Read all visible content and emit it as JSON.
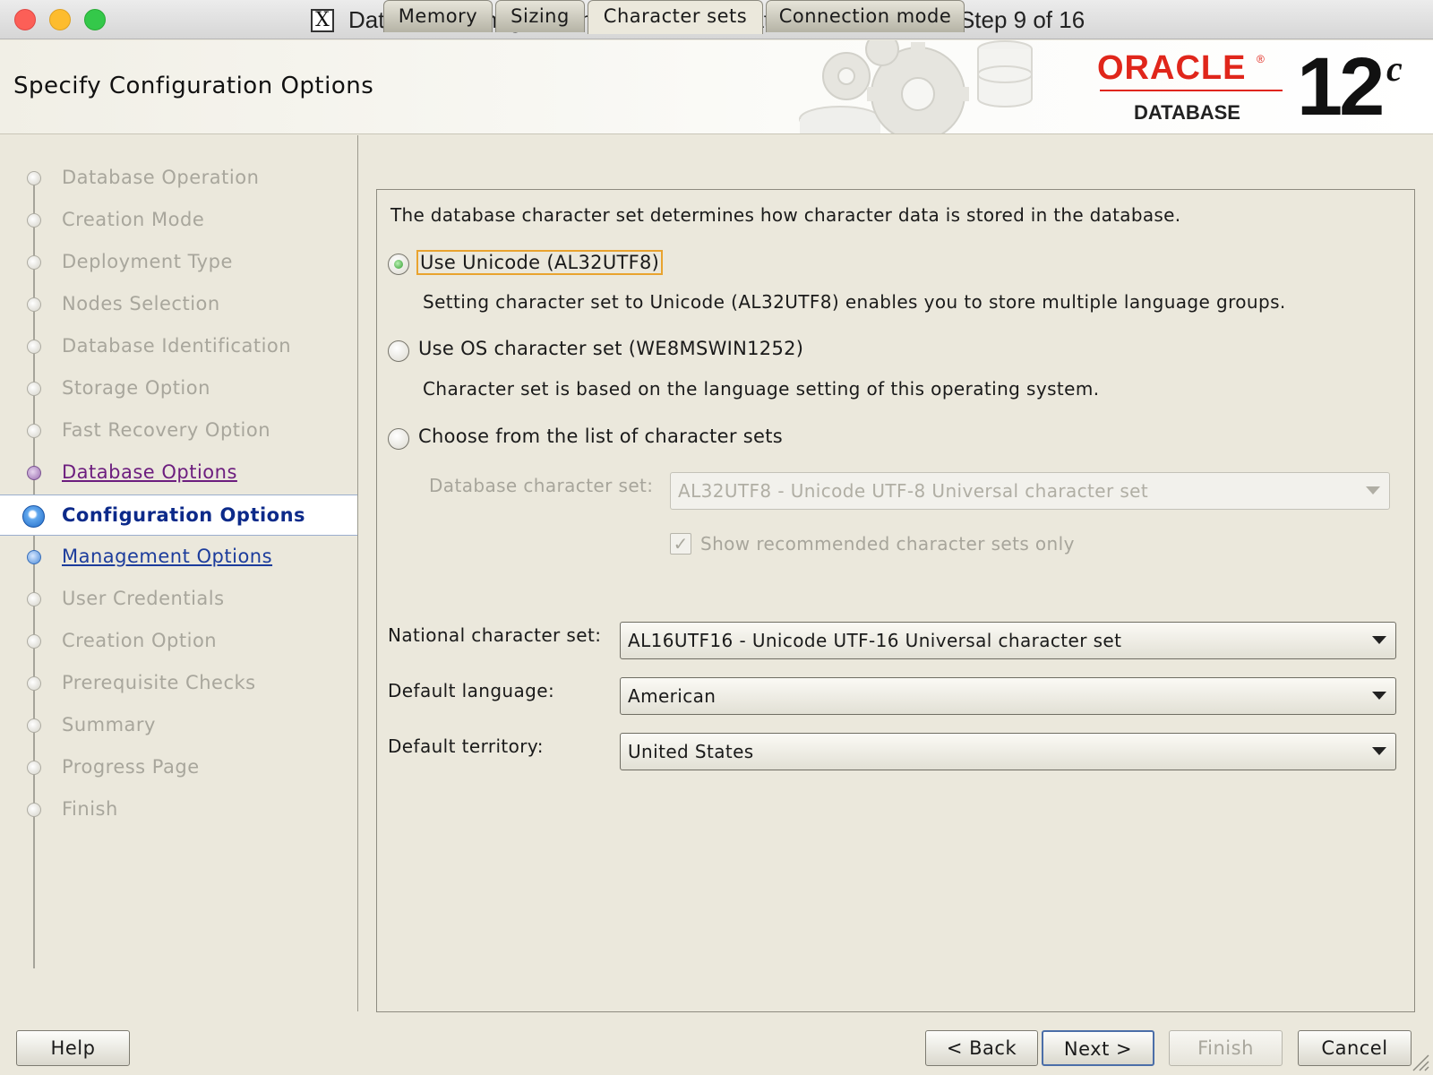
{
  "window": {
    "title": "Database Configuration Assistant - Create 'orcl' database - Step 9 of 16"
  },
  "header": {
    "heading": "Specify Configuration Options",
    "logo_word": "ORACLE",
    "logo_trademark": "®",
    "logo_product": "DATABASE",
    "logo_version": "12",
    "logo_version_sup": "c"
  },
  "steps": [
    {
      "label": "Database Operation",
      "state": "disabled"
    },
    {
      "label": "Creation Mode",
      "state": "disabled"
    },
    {
      "label": "Deployment Type",
      "state": "disabled"
    },
    {
      "label": "Nodes Selection",
      "state": "disabled"
    },
    {
      "label": "Database Identification",
      "state": "disabled"
    },
    {
      "label": "Storage Option",
      "state": "disabled"
    },
    {
      "label": "Fast Recovery Option",
      "state": "disabled"
    },
    {
      "label": "Database Options",
      "state": "done"
    },
    {
      "label": "Configuration Options",
      "state": "current"
    },
    {
      "label": "Management Options",
      "state": "link"
    },
    {
      "label": "User Credentials",
      "state": "disabled"
    },
    {
      "label": "Creation Option",
      "state": "disabled"
    },
    {
      "label": "Prerequisite Checks",
      "state": "disabled"
    },
    {
      "label": "Summary",
      "state": "disabled"
    },
    {
      "label": "Progress Page",
      "state": "disabled"
    },
    {
      "label": "Finish",
      "state": "disabled"
    }
  ],
  "tabs": [
    {
      "label": "Memory"
    },
    {
      "label": "Sizing"
    },
    {
      "label": "Character sets",
      "active": true
    },
    {
      "label": "Connection mode"
    }
  ],
  "charset": {
    "intro": "The database character set determines how character data is stored in the database.",
    "options": [
      {
        "label": "Use Unicode (AL32UTF8)",
        "description": "Setting character set to Unicode (AL32UTF8) enables you to store multiple language groups.",
        "checked": true
      },
      {
        "label": "Use OS character set (WE8MSWIN1252)",
        "description": "Character set is based on the language setting of this operating system.",
        "checked": false
      },
      {
        "label": "Choose from the list of character sets",
        "checked": false
      }
    ],
    "db_charset_label": "Database character set:",
    "db_charset_value": "AL32UTF8 - Unicode UTF-8 Universal character set",
    "show_recommended_label": "Show recommended character sets only",
    "show_recommended_checked": true,
    "national_label": "National character set:",
    "national_value": "AL16UTF16 - Unicode UTF-16 Universal character set",
    "language_label": "Default language:",
    "language_value": "American",
    "territory_label": "Default territory:",
    "territory_value": "United States"
  },
  "buttons": {
    "help": "Help",
    "back": "< Back",
    "next": "Next >",
    "finish": "Finish",
    "cancel": "Cancel"
  },
  "colors": {
    "oracle_red": "#e0261b",
    "current_step": "#0c2a8a",
    "link_step": "#1c3c9c",
    "visited_step": "#6c1d7e",
    "focus_ring": "#e9a32e"
  }
}
